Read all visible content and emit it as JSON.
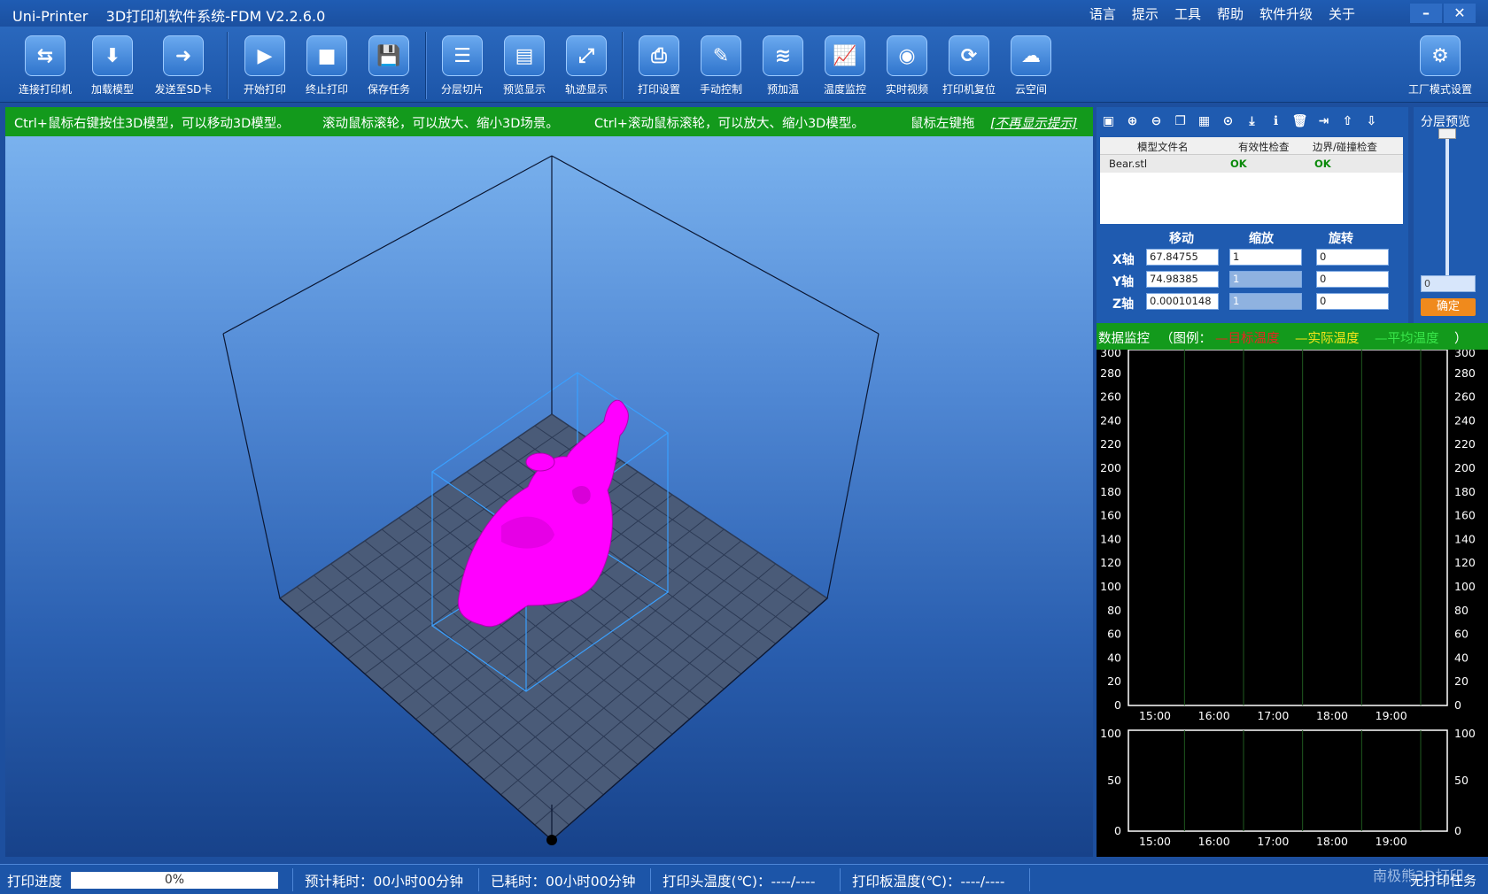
{
  "app": {
    "title": "Uni-Printer    3D打印机软件系统-FDM V2.2.6.0",
    "menus": [
      "语言",
      "提示",
      "工具",
      "帮助",
      "软件升级",
      "关于"
    ],
    "minimize": "–",
    "close": "✕"
  },
  "toolbar": [
    {
      "label": "连接打印机",
      "icon": "printer-connect-icon",
      "glyph": "⇆"
    },
    {
      "label": "加载模型",
      "icon": "load-model-icon",
      "glyph": "⬇"
    },
    {
      "label": "发送至SD卡",
      "icon": "sd-card-icon",
      "glyph": "➜"
    },
    {
      "label": "开始打印",
      "icon": "play-icon",
      "glyph": "▶"
    },
    {
      "label": "终止打印",
      "icon": "stop-icon",
      "glyph": "■"
    },
    {
      "label": "保存任务",
      "icon": "save-task-icon",
      "glyph": "💾"
    },
    {
      "label": "分层切片",
      "icon": "slice-icon",
      "glyph": "☰"
    },
    {
      "label": "预览显示",
      "icon": "preview-icon",
      "glyph": "▤"
    },
    {
      "label": "轨迹显示",
      "icon": "trajectory-icon",
      "glyph": "⤢"
    },
    {
      "label": "打印设置",
      "icon": "print-settings-icon",
      "glyph": "⎙"
    },
    {
      "label": "手动控制",
      "icon": "wrench-icon",
      "glyph": "✎"
    },
    {
      "label": "预加温",
      "icon": "preheat-icon",
      "glyph": "≋"
    },
    {
      "label": "温度监控",
      "icon": "temperature-chart-icon",
      "glyph": "📈"
    },
    {
      "label": "实时视频",
      "icon": "webcam-icon",
      "glyph": "◉"
    },
    {
      "label": "打印机复位",
      "icon": "reset-icon",
      "glyph": "⟳"
    },
    {
      "label": "云空间",
      "icon": "cloud-icon",
      "glyph": "☁"
    },
    {
      "label": "工厂模式设置",
      "icon": "gear-icon",
      "glyph": "⚙"
    }
  ],
  "hints": {
    "h1": "Ctrl+鼠标右键按住3D模型，可以移动3D模型。",
    "h2": "滚动鼠标滚轮，可以放大、缩小3D场景。",
    "h3": "Ctrl+滚动鼠标滚轮，可以放大、缩小3D模型。",
    "h4": "鼠标左键拖",
    "hide": "[不再显示提示]"
  },
  "model_table": {
    "headers": [
      "模型文件名",
      "有效性检查",
      "边界/碰撞检查"
    ],
    "rows": [
      {
        "file": "Bear.stl",
        "validity": "OK",
        "boundary": "OK"
      }
    ]
  },
  "transform": {
    "headers": {
      "move": "移动",
      "scale": "缩放",
      "rotate": "旋转"
    },
    "axes": [
      {
        "label": "X轴",
        "move": "67.84755",
        "scale": "1",
        "rotate": "0"
      },
      {
        "label": "Y轴",
        "move": "74.98385",
        "scale": "1",
        "rotate": "0"
      },
      {
        "label": "Z轴",
        "move": "0.00010148",
        "scale": "1",
        "rotate": "0"
      }
    ]
  },
  "layer_preview": {
    "title": "分层预览",
    "value": "0",
    "confirm": "确定"
  },
  "monitor": {
    "title": "数据监控",
    "legend_prefix": "（图例：",
    "legend_suffix": "）",
    "legend": [
      {
        "name": "—目标温度",
        "color": "#e52620"
      },
      {
        "name": "—实际温度",
        "color": "#f7e619"
      },
      {
        "name": "—平均温度",
        "color": "#39e64a"
      }
    ]
  },
  "chart_data": [
    {
      "type": "line",
      "x": [
        "15:00",
        "16:00",
        "17:00",
        "18:00",
        "19:00"
      ],
      "series": [],
      "yticks": [
        0,
        20,
        40,
        60,
        80,
        100,
        120,
        140,
        160,
        180,
        200,
        220,
        240,
        260,
        280,
        300
      ],
      "ylim": [
        0,
        300
      ],
      "grid": true
    },
    {
      "type": "line",
      "x": [
        "15:00",
        "16:00",
        "17:00",
        "18:00",
        "19:00"
      ],
      "series": [],
      "yticks": [
        0,
        50,
        100
      ],
      "ylim": [
        0,
        100
      ],
      "grid": true
    }
  ],
  "status": {
    "progress_label": "打印进度",
    "progress": 0,
    "progress_text": "0%",
    "eta": "预计耗时：00小时00分钟",
    "elapsed": "已耗时：00小时00分钟",
    "head_temp": "打印头温度(℃)：----/----",
    "bed_temp": "打印板温度(℃)：----/----",
    "task": "无打印任务",
    "watermark": "南极熊3D打印"
  },
  "colors": {
    "model": "#ff00ff",
    "hint_bar": "#139a1c",
    "accent": "#f08a1c"
  }
}
